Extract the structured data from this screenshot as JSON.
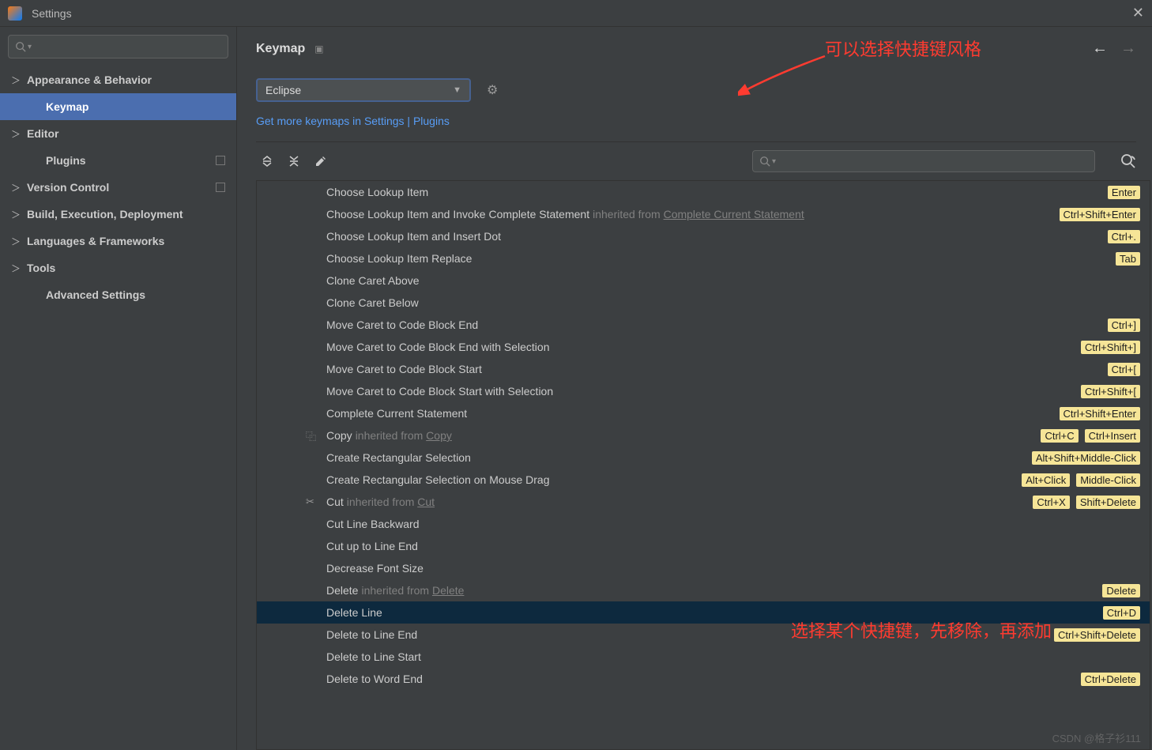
{
  "window": {
    "title": "Settings"
  },
  "sidebar": {
    "items": [
      {
        "label": "Appearance & Behavior",
        "expandable": true
      },
      {
        "label": "Keymap",
        "selected": true,
        "child": true
      },
      {
        "label": "Editor",
        "expandable": true
      },
      {
        "label": "Plugins",
        "child": true,
        "box": true
      },
      {
        "label": "Version Control",
        "expandable": true,
        "box": true
      },
      {
        "label": "Build, Execution, Deployment",
        "expandable": true
      },
      {
        "label": "Languages & Frameworks",
        "expandable": true
      },
      {
        "label": "Tools",
        "expandable": true
      },
      {
        "label": "Advanced Settings",
        "child": true
      }
    ]
  },
  "header": {
    "title": "Keymap"
  },
  "dropdown": {
    "value": "Eclipse"
  },
  "link": {
    "text": "Get more keymaps in Settings | Plugins"
  },
  "annotations": {
    "a1": "可以选择快捷键风格",
    "a2": "选择某个快捷键，先移除，再添加"
  },
  "actions": [
    {
      "text": "Choose Lookup Item",
      "shortcuts": [
        "Enter"
      ]
    },
    {
      "text": "Choose Lookup Item and Invoke Complete Statement",
      "inherit": "Complete Current Statement",
      "shortcuts": [
        "Ctrl+Shift+Enter"
      ]
    },
    {
      "text": "Choose Lookup Item and Insert Dot",
      "shortcuts": [
        "Ctrl+."
      ]
    },
    {
      "text": "Choose Lookup Item Replace",
      "shortcuts": [
        "Tab"
      ]
    },
    {
      "text": "Clone Caret Above"
    },
    {
      "text": "Clone Caret Below"
    },
    {
      "text": "Move Caret to Code Block End",
      "shortcuts": [
        "Ctrl+]"
      ]
    },
    {
      "text": "Move Caret to Code Block End with Selection",
      "shortcuts": [
        "Ctrl+Shift+]"
      ]
    },
    {
      "text": "Move Caret to Code Block Start",
      "shortcuts": [
        "Ctrl+["
      ]
    },
    {
      "text": "Move Caret to Code Block Start with Selection",
      "shortcuts": [
        "Ctrl+Shift+["
      ]
    },
    {
      "text": "Complete Current Statement",
      "shortcuts": [
        "Ctrl+Shift+Enter"
      ]
    },
    {
      "text": "Copy",
      "inherit": "Copy",
      "icon": "copy",
      "shortcuts": [
        "Ctrl+C",
        "Ctrl+Insert"
      ]
    },
    {
      "text": "Create Rectangular Selection",
      "shortcuts": [
        "Alt+Shift+Middle-Click"
      ]
    },
    {
      "text": "Create Rectangular Selection on Mouse Drag",
      "shortcuts": [
        "Alt+Click",
        "Middle-Click"
      ]
    },
    {
      "text": "Cut",
      "inherit": "Cut",
      "icon": "cut",
      "shortcuts": [
        "Ctrl+X",
        "Shift+Delete"
      ]
    },
    {
      "text": "Cut Line Backward"
    },
    {
      "text": "Cut up to Line End"
    },
    {
      "text": "Decrease Font Size"
    },
    {
      "text": "Delete",
      "inherit": "Delete",
      "shortcuts": [
        "Delete"
      ]
    },
    {
      "text": "Delete Line",
      "selected": true,
      "shortcuts": [
        "Ctrl+D"
      ]
    },
    {
      "text": "Delete to Line End",
      "shortcuts": [
        "Ctrl+Shift+Delete"
      ]
    },
    {
      "text": "Delete to Line Start"
    },
    {
      "text": "Delete to Word End",
      "shortcuts": [
        "Ctrl+Delete"
      ]
    }
  ],
  "inherit_prefix": "inherited from",
  "watermark": "CSDN @格子衫111"
}
